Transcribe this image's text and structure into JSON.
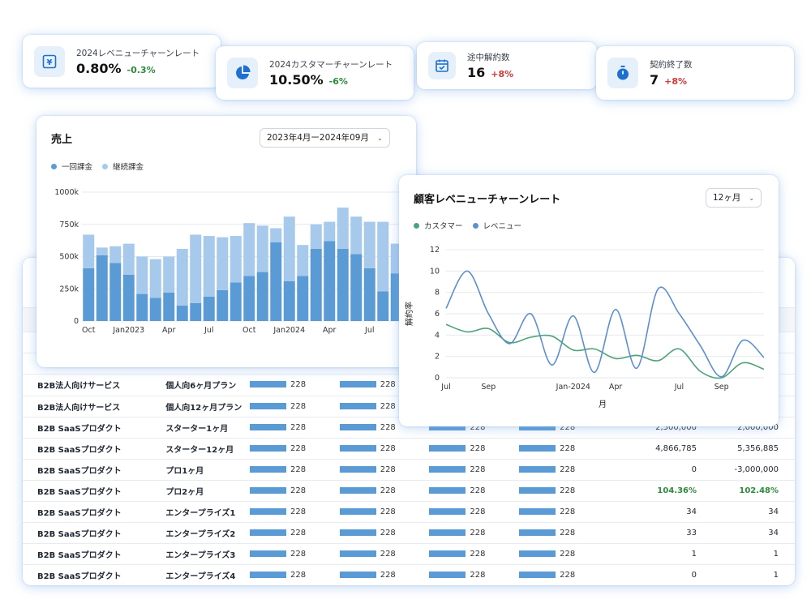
{
  "kpis": [
    {
      "label": "2024レベニューチャーンレート",
      "value": "0.80%",
      "change": "-0.3%",
      "icon": "yen-icon"
    },
    {
      "label": "2024カスタマーチャーンレート",
      "value": "10.50%",
      "change": "-6%",
      "icon": "pie-icon"
    },
    {
      "label": "途中解約数",
      "value": "16",
      "change": "+8%",
      "icon": "calendar-check-icon"
    },
    {
      "label": "契約終了数",
      "value": "7",
      "change": "+8%",
      "icon": "stopwatch-icon"
    }
  ],
  "sales": {
    "title": "売上",
    "period_select": "2023年4月ー2024年09月",
    "legend": [
      "一回課金",
      "継続課金"
    ]
  },
  "churn": {
    "title": "顧客レベニューチャーンレート",
    "period_select": "12ヶ月",
    "legend": [
      "カスタマー",
      "レベニュー"
    ]
  },
  "table": {
    "rows": [
      {
        "c1": "B2B法人向けサービス",
        "c2": "個人向6ヶ月プラン",
        "bars": [
          "228",
          "228",
          "228",
          "228"
        ],
        "c7": "",
        "c8": "",
        "highlight": false
      },
      {
        "c1": "B2B法人向けサービス",
        "c2": "個人向12ヶ月プラン",
        "bars": [
          "228",
          "228",
          "228",
          "228"
        ],
        "c7": "",
        "c8": "",
        "highlight": false
      },
      {
        "c1": "B2B SaaSプロダクト",
        "c2": "スターター1ヶ月",
        "bars": [
          "228",
          "228",
          "228",
          "228"
        ],
        "c7": "2,500,000",
        "c8": "2,000,000",
        "highlight": false
      },
      {
        "c1": "B2B SaaSプロダクト",
        "c2": "スターター12ヶ月",
        "bars": [
          "228",
          "228",
          "228",
          "228"
        ],
        "c7": "4,866,785",
        "c8": "5,356,885",
        "highlight": false
      },
      {
        "c1": "B2B SaaSプロダクト",
        "c2": "プロ1ヶ月",
        "bars": [
          "228",
          "228",
          "228",
          "228"
        ],
        "c7": "0",
        "c8": "-3,000,000",
        "highlight": false
      },
      {
        "c1": "B2B SaaSプロダクト",
        "c2": "プロ2ヶ月",
        "bars": [
          "228",
          "228",
          "228",
          "228"
        ],
        "c7": "104.36%",
        "c8": "102.48%",
        "highlight": true
      },
      {
        "c1": "B2B SaaSプロダクト",
        "c2": "エンタープライズ1",
        "bars": [
          "228",
          "228",
          "228",
          "228"
        ],
        "c7": "34",
        "c8": "34",
        "highlight": false
      },
      {
        "c1": "B2B SaaSプロダクト",
        "c2": "エンタープライズ2",
        "bars": [
          "228",
          "228",
          "228",
          "228"
        ],
        "c7": "33",
        "c8": "34",
        "highlight": false
      },
      {
        "c1": "B2B SaaSプロダクト",
        "c2": "エンタープライズ3",
        "bars": [
          "228",
          "228",
          "228",
          "228"
        ],
        "c7": "1",
        "c8": "1",
        "highlight": false
      },
      {
        "c1": "B2B SaaSプロダクト",
        "c2": "エンタープライズ4",
        "bars": [
          "228",
          "228",
          "228",
          "228"
        ],
        "c7": "0",
        "c8": "1",
        "highlight": false
      }
    ]
  },
  "chart_data": [
    {
      "type": "bar",
      "title": "売上",
      "stacked": true,
      "ylim": [
        0,
        1000000
      ],
      "yticks": [
        "0",
        "250k",
        "500k",
        "750k",
        "1000k"
      ],
      "xtick_labels": [
        {
          "index": 0,
          "label": "Oct"
        },
        {
          "index": 3,
          "label": "Jan2023"
        },
        {
          "index": 6,
          "label": "Apr"
        },
        {
          "index": 9,
          "label": "Jul"
        },
        {
          "index": 12,
          "label": "Oct"
        },
        {
          "index": 15,
          "label": "Jan2024"
        },
        {
          "index": 18,
          "label": "Apr"
        },
        {
          "index": 21,
          "label": "Jul"
        }
      ],
      "series": [
        {
          "name": "一回課金",
          "color": "#5b9bd5",
          "values": [
            410000,
            510000,
            450000,
            360000,
            210000,
            180000,
            220000,
            120000,
            140000,
            190000,
            240000,
            300000,
            350000,
            380000,
            610000,
            310000,
            350000,
            560000,
            620000,
            560000,
            520000,
            410000,
            230000,
            370000
          ]
        },
        {
          "name": "継続課金",
          "color": "#a7c9ec",
          "values": [
            260000,
            60000,
            130000,
            240000,
            290000,
            300000,
            280000,
            440000,
            530000,
            470000,
            410000,
            360000,
            410000,
            360000,
            110000,
            500000,
            240000,
            190000,
            150000,
            320000,
            290000,
            360000,
            540000,
            230000
          ]
        }
      ]
    },
    {
      "type": "line",
      "title": "顧客レベニューチャーンレート",
      "xlabel": "月",
      "ylabel": "解約率",
      "ylim": [
        0,
        12
      ],
      "yticks": [
        "0",
        "2",
        "4",
        "6",
        "8",
        "10",
        "12"
      ],
      "x_tick_labels": [
        {
          "index": 0,
          "label": "Jul"
        },
        {
          "index": 2,
          "label": "Sep"
        },
        {
          "index": 6,
          "label": "Jan-2024"
        },
        {
          "index": 8,
          "label": "Apr"
        },
        {
          "index": 11,
          "label": "Jul"
        },
        {
          "index": 13,
          "label": "Sep"
        }
      ],
      "n_points": 16,
      "series": [
        {
          "name": "カスタマー",
          "color": "#4da27a",
          "values": [
            5.0,
            4.3,
            4.6,
            3.3,
            3.8,
            3.9,
            2.6,
            2.7,
            1.8,
            2.1,
            1.6,
            2.7,
            0.6,
            0.0,
            1.4,
            0.8
          ]
        },
        {
          "name": "レベニュー",
          "color": "#5b8fd0",
          "values": [
            6.5,
            10.0,
            6.0,
            3.2,
            6.0,
            1.2,
            5.8,
            0.5,
            6.4,
            0.9,
            8.3,
            6.0,
            3.0,
            0.1,
            3.5,
            1.9
          ]
        }
      ]
    }
  ]
}
